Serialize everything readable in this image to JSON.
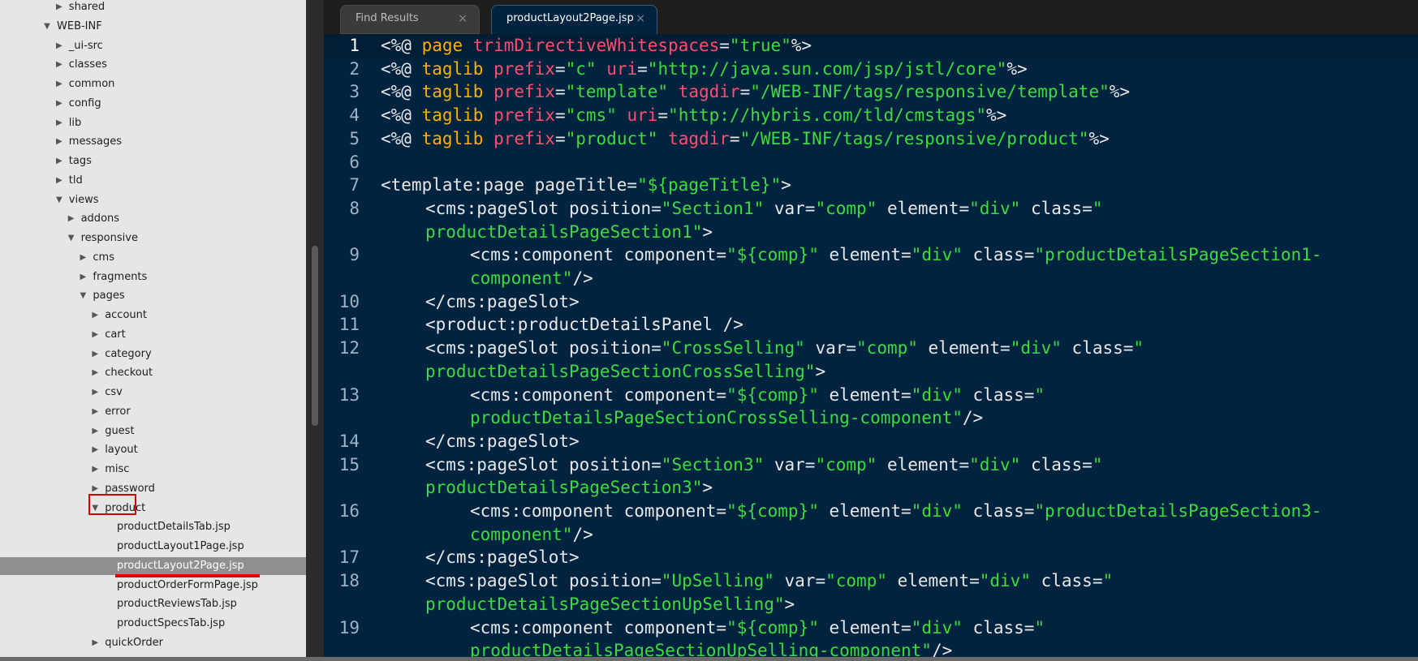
{
  "sidebar": {
    "items": [
      {
        "label": "shared",
        "depth": 1,
        "state": "collapsed"
      },
      {
        "label": "WEB-INF",
        "depth": 0,
        "state": "expanded"
      },
      {
        "label": "_ui-src",
        "depth": 1,
        "state": "collapsed"
      },
      {
        "label": "classes",
        "depth": 1,
        "state": "collapsed"
      },
      {
        "label": "common",
        "depth": 1,
        "state": "collapsed"
      },
      {
        "label": "config",
        "depth": 1,
        "state": "collapsed"
      },
      {
        "label": "lib",
        "depth": 1,
        "state": "collapsed"
      },
      {
        "label": "messages",
        "depth": 1,
        "state": "collapsed"
      },
      {
        "label": "tags",
        "depth": 1,
        "state": "collapsed"
      },
      {
        "label": "tld",
        "depth": 1,
        "state": "collapsed"
      },
      {
        "label": "views",
        "depth": 1,
        "state": "expanded"
      },
      {
        "label": "addons",
        "depth": 2,
        "state": "collapsed"
      },
      {
        "label": "responsive",
        "depth": 2,
        "state": "expanded"
      },
      {
        "label": "cms",
        "depth": 3,
        "state": "collapsed"
      },
      {
        "label": "fragments",
        "depth": 3,
        "state": "collapsed"
      },
      {
        "label": "pages",
        "depth": 3,
        "state": "expanded"
      },
      {
        "label": "account",
        "depth": 4,
        "state": "collapsed"
      },
      {
        "label": "cart",
        "depth": 4,
        "state": "collapsed"
      },
      {
        "label": "category",
        "depth": 4,
        "state": "collapsed"
      },
      {
        "label": "checkout",
        "depth": 4,
        "state": "collapsed"
      },
      {
        "label": "csv",
        "depth": 4,
        "state": "collapsed"
      },
      {
        "label": "error",
        "depth": 4,
        "state": "collapsed"
      },
      {
        "label": "guest",
        "depth": 4,
        "state": "collapsed"
      },
      {
        "label": "layout",
        "depth": 4,
        "state": "collapsed"
      },
      {
        "label": "misc",
        "depth": 4,
        "state": "collapsed"
      },
      {
        "label": "password",
        "depth": 4,
        "state": "collapsed"
      },
      {
        "label": "product",
        "depth": 4,
        "state": "expanded"
      },
      {
        "label": "productDetailsTab.jsp",
        "depth": 5,
        "state": "file"
      },
      {
        "label": "productLayout1Page.jsp",
        "depth": 5,
        "state": "file"
      },
      {
        "label": "productLayout2Page.jsp",
        "depth": 5,
        "state": "file",
        "selected": true
      },
      {
        "label": "productOrderFormPage.jsp",
        "depth": 5,
        "state": "file"
      },
      {
        "label": "productReviewsTab.jsp",
        "depth": 5,
        "state": "file"
      },
      {
        "label": "productSpecsTab.jsp",
        "depth": 5,
        "state": "file"
      },
      {
        "label": "quickOrder",
        "depth": 4,
        "state": "collapsed"
      }
    ]
  },
  "tabs": [
    {
      "label": "Find Results",
      "close": "×",
      "active": false
    },
    {
      "label": "productLayout2Page.jsp",
      "close": "×",
      "active": true
    }
  ],
  "colors": {
    "editor_bg": "#002340",
    "keyword": "#ffb000",
    "attribute": "#ff4f6f",
    "string": "#3ddc3d",
    "plain": "#e8e8e8",
    "annotation_red": "#d40000"
  },
  "code_rows": [
    {
      "ln": "1",
      "indent": 0,
      "current": true,
      "tokens": [
        [
          "pl",
          "<%@ "
        ],
        [
          "kw",
          "page "
        ],
        [
          "at",
          "trimDirectiveWhitespaces"
        ],
        [
          "pl",
          "="
        ],
        [
          "st",
          "\"true\""
        ],
        [
          "pl",
          "%>"
        ]
      ]
    },
    {
      "ln": "2",
      "indent": 0,
      "tokens": [
        [
          "pl",
          "<%@ "
        ],
        [
          "kw",
          "taglib "
        ],
        [
          "at",
          "prefix"
        ],
        [
          "pl",
          "="
        ],
        [
          "st",
          "\"c\""
        ],
        [
          "pl",
          " "
        ],
        [
          "at",
          "uri"
        ],
        [
          "pl",
          "="
        ],
        [
          "st",
          "\"http://java.sun.com/jsp/jstl/core\""
        ],
        [
          "pl",
          "%>"
        ]
      ]
    },
    {
      "ln": "3",
      "indent": 0,
      "tokens": [
        [
          "pl",
          "<%@ "
        ],
        [
          "kw",
          "taglib "
        ],
        [
          "at",
          "prefix"
        ],
        [
          "pl",
          "="
        ],
        [
          "st",
          "\"template\""
        ],
        [
          "pl",
          " "
        ],
        [
          "at",
          "tagdir"
        ],
        [
          "pl",
          "="
        ],
        [
          "st",
          "\"/WEB-INF/tags/responsive/template\""
        ],
        [
          "pl",
          "%>"
        ]
      ]
    },
    {
      "ln": "4",
      "indent": 0,
      "tokens": [
        [
          "pl",
          "<%@ "
        ],
        [
          "kw",
          "taglib "
        ],
        [
          "at",
          "prefix"
        ],
        [
          "pl",
          "="
        ],
        [
          "st",
          "\"cms\""
        ],
        [
          "pl",
          " "
        ],
        [
          "at",
          "uri"
        ],
        [
          "pl",
          "="
        ],
        [
          "st",
          "\"http://hybris.com/tld/cmstags\""
        ],
        [
          "pl",
          "%>"
        ]
      ]
    },
    {
      "ln": "5",
      "indent": 0,
      "tokens": [
        [
          "pl",
          "<%@ "
        ],
        [
          "kw",
          "taglib "
        ],
        [
          "at",
          "prefix"
        ],
        [
          "pl",
          "="
        ],
        [
          "st",
          "\"product\""
        ],
        [
          "pl",
          " "
        ],
        [
          "at",
          "tagdir"
        ],
        [
          "pl",
          "="
        ],
        [
          "st",
          "\"/WEB-INF/tags/responsive/product\""
        ],
        [
          "pl",
          "%>"
        ]
      ]
    },
    {
      "ln": "6",
      "indent": 0,
      "tokens": []
    },
    {
      "ln": "7",
      "indent": 0,
      "tokens": [
        [
          "pl",
          "<template:page pageTitle="
        ],
        [
          "st",
          "\"${pageTitle}\""
        ],
        [
          "pl",
          ">"
        ]
      ]
    },
    {
      "ln": "8",
      "indent": 1,
      "tokens": [
        [
          "pl",
          "<cms:pageSlot position="
        ],
        [
          "st",
          "\"Section1\""
        ],
        [
          "pl",
          " var="
        ],
        [
          "st",
          "\"comp\""
        ],
        [
          "pl",
          " element="
        ],
        [
          "st",
          "\"div\""
        ],
        [
          "pl",
          " class="
        ],
        [
          "st",
          "\""
        ]
      ]
    },
    {
      "ln": "",
      "indent": 1,
      "tokens": [
        [
          "st",
          "productDetailsPageSection1\""
        ],
        [
          "pl",
          ">"
        ]
      ]
    },
    {
      "ln": "9",
      "indent": 2,
      "tokens": [
        [
          "pl",
          "<cms:component component="
        ],
        [
          "st",
          "\"${comp}\""
        ],
        [
          "pl",
          " element="
        ],
        [
          "st",
          "\"div\""
        ],
        [
          "pl",
          " class="
        ],
        [
          "st",
          "\"productDetailsPageSection1-"
        ]
      ]
    },
    {
      "ln": "",
      "indent": 2,
      "tokens": [
        [
          "st",
          "component\""
        ],
        [
          "pl",
          "/>"
        ]
      ]
    },
    {
      "ln": "10",
      "indent": 1,
      "tokens": [
        [
          "pl",
          "</cms:pageSlot>"
        ]
      ]
    },
    {
      "ln": "11",
      "indent": 1,
      "tokens": [
        [
          "pl",
          "<product:productDetailsPanel />"
        ]
      ]
    },
    {
      "ln": "12",
      "indent": 1,
      "tokens": [
        [
          "pl",
          "<cms:pageSlot position="
        ],
        [
          "st",
          "\"CrossSelling\""
        ],
        [
          "pl",
          " var="
        ],
        [
          "st",
          "\"comp\""
        ],
        [
          "pl",
          " element="
        ],
        [
          "st",
          "\"div\""
        ],
        [
          "pl",
          " class="
        ],
        [
          "st",
          "\""
        ]
      ]
    },
    {
      "ln": "",
      "indent": 1,
      "tokens": [
        [
          "st",
          "productDetailsPageSectionCrossSelling\""
        ],
        [
          "pl",
          ">"
        ]
      ]
    },
    {
      "ln": "13",
      "indent": 2,
      "tokens": [
        [
          "pl",
          "<cms:component component="
        ],
        [
          "st",
          "\"${comp}\""
        ],
        [
          "pl",
          " element="
        ],
        [
          "st",
          "\"div\""
        ],
        [
          "pl",
          " class="
        ],
        [
          "st",
          "\""
        ]
      ]
    },
    {
      "ln": "",
      "indent": 2,
      "tokens": [
        [
          "st",
          "productDetailsPageSectionCrossSelling-component\""
        ],
        [
          "pl",
          "/>"
        ]
      ]
    },
    {
      "ln": "14",
      "indent": 1,
      "tokens": [
        [
          "pl",
          "</cms:pageSlot>"
        ]
      ]
    },
    {
      "ln": "15",
      "indent": 1,
      "tokens": [
        [
          "pl",
          "<cms:pageSlot position="
        ],
        [
          "st",
          "\"Section3\""
        ],
        [
          "pl",
          " var="
        ],
        [
          "st",
          "\"comp\""
        ],
        [
          "pl",
          " element="
        ],
        [
          "st",
          "\"div\""
        ],
        [
          "pl",
          " class="
        ],
        [
          "st",
          "\""
        ]
      ]
    },
    {
      "ln": "",
      "indent": 1,
      "tokens": [
        [
          "st",
          "productDetailsPageSection3\""
        ],
        [
          "pl",
          ">"
        ]
      ]
    },
    {
      "ln": "16",
      "indent": 2,
      "tokens": [
        [
          "pl",
          "<cms:component component="
        ],
        [
          "st",
          "\"${comp}\""
        ],
        [
          "pl",
          " element="
        ],
        [
          "st",
          "\"div\""
        ],
        [
          "pl",
          " class="
        ],
        [
          "st",
          "\"productDetailsPageSection3-"
        ]
      ]
    },
    {
      "ln": "",
      "indent": 2,
      "tokens": [
        [
          "st",
          "component\""
        ],
        [
          "pl",
          "/>"
        ]
      ]
    },
    {
      "ln": "17",
      "indent": 1,
      "tokens": [
        [
          "pl",
          "</cms:pageSlot>"
        ]
      ]
    },
    {
      "ln": "18",
      "indent": 1,
      "tokens": [
        [
          "pl",
          "<cms:pageSlot position="
        ],
        [
          "st",
          "\"UpSelling\""
        ],
        [
          "pl",
          " var="
        ],
        [
          "st",
          "\"comp\""
        ],
        [
          "pl",
          " element="
        ],
        [
          "st",
          "\"div\""
        ],
        [
          "pl",
          " class="
        ],
        [
          "st",
          "\""
        ]
      ]
    },
    {
      "ln": "",
      "indent": 1,
      "tokens": [
        [
          "st",
          "productDetailsPageSectionUpSelling\""
        ],
        [
          "pl",
          ">"
        ]
      ]
    },
    {
      "ln": "19",
      "indent": 2,
      "tokens": [
        [
          "pl",
          "<cms:component component="
        ],
        [
          "st",
          "\"${comp}\""
        ],
        [
          "pl",
          " element="
        ],
        [
          "st",
          "\"div\""
        ],
        [
          "pl",
          " class="
        ],
        [
          "st",
          "\""
        ]
      ]
    },
    {
      "ln": "",
      "indent": 2,
      "tokens": [
        [
          "st",
          "productDetailsPageSectionUpSelling-component\""
        ],
        [
          "pl",
          "/>"
        ]
      ]
    }
  ]
}
